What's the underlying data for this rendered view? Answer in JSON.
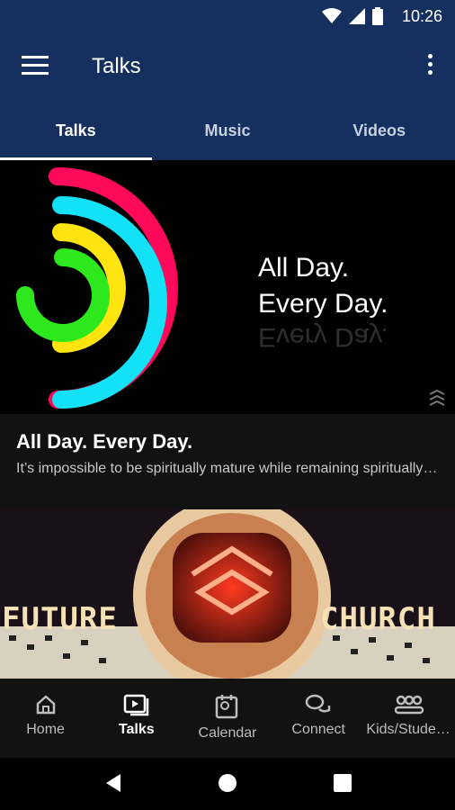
{
  "status_bar": {
    "time": "10:26"
  },
  "app_bar": {
    "title": "Talks"
  },
  "tabs": [
    {
      "label": "Talks",
      "active": true
    },
    {
      "label": "Music",
      "active": false
    },
    {
      "label": "Videos",
      "active": false
    }
  ],
  "cards": [
    {
      "image_text_line1": "All Day.",
      "image_text_line2": "Every Day.",
      "title": "All Day. Every Day.",
      "subtitle": "It’s impossible to be spiritually mature while remaining spiritually isolated."
    },
    {
      "image_text_left": "FUTURE",
      "image_text_right": "CHURCH"
    }
  ],
  "bottom_nav": [
    {
      "label": "Home",
      "icon": "home-icon",
      "active": false
    },
    {
      "label": "Talks",
      "icon": "talks-icon",
      "active": true
    },
    {
      "label": "Calendar",
      "icon": "calendar-icon",
      "active": false
    },
    {
      "label": "Connect",
      "icon": "connect-icon",
      "active": false
    },
    {
      "label": "Kids/Students",
      "icon": "kids-icon",
      "active": false
    }
  ],
  "colors": {
    "primary": "#15305f",
    "background": "#121212"
  }
}
